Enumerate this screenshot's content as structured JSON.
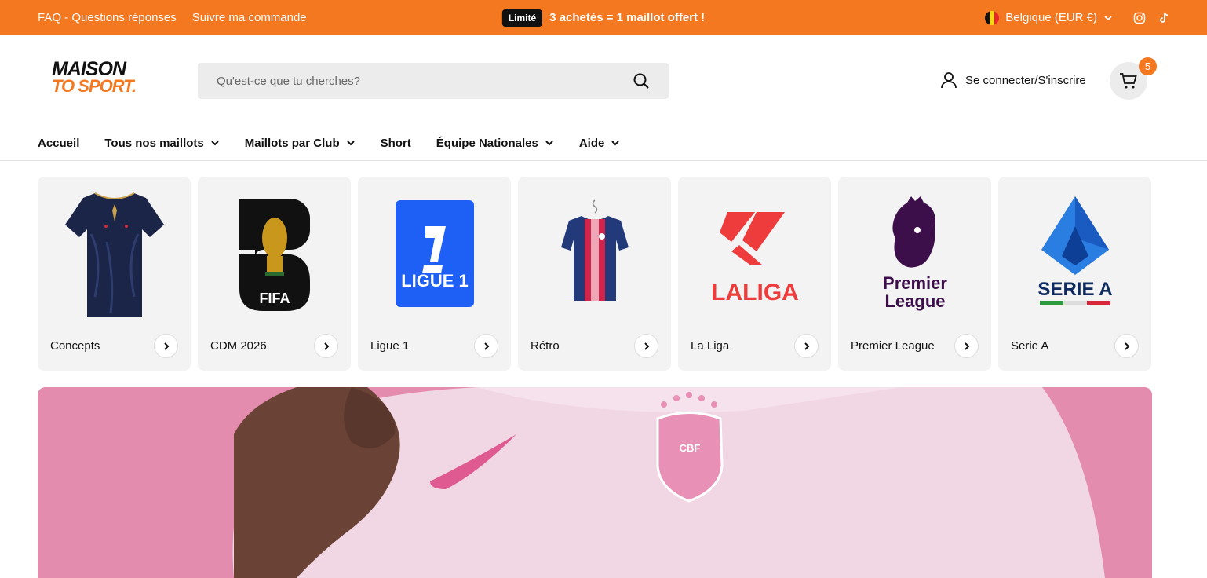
{
  "topbar": {
    "links": [
      "FAQ - Questions réponses",
      "Suivre ma commande"
    ],
    "badge": "Limité",
    "promo": "3 achetés = 1 maillot offert !",
    "country": "Belgique (EUR €)",
    "social": [
      "instagram-icon",
      "tiktok-icon"
    ],
    "background": "#f47820"
  },
  "header": {
    "logo_line1": "MAISON",
    "logo_line2": "TO SPORT.",
    "search_placeholder": "Qu'est-ce que tu cherches?",
    "account_label": "Se connecter/S'inscrire",
    "cart_count": "5"
  },
  "nav": {
    "items": [
      {
        "label": "Accueil",
        "dropdown": false
      },
      {
        "label": "Tous nos maillots",
        "dropdown": true
      },
      {
        "label": "Maillots par Club",
        "dropdown": true
      },
      {
        "label": "Short",
        "dropdown": false
      },
      {
        "label": "Équipe Nationales",
        "dropdown": true
      },
      {
        "label": "Aide",
        "dropdown": true
      }
    ]
  },
  "categories": [
    {
      "label": "Concepts",
      "icon": "concept-jersey-image"
    },
    {
      "label": "CDM 2026",
      "icon": "fifa-2026-logo"
    },
    {
      "label": "Ligue 1",
      "icon": "ligue1-logo"
    },
    {
      "label": "Rétro",
      "icon": "retro-jersey-image"
    },
    {
      "label": "La Liga",
      "icon": "laliga-logo"
    },
    {
      "label": "Premier League",
      "icon": "premier-league-logo"
    },
    {
      "label": "Serie A",
      "icon": "serie-a-logo"
    }
  ],
  "logo_text": {
    "fifa": "FIFA",
    "ligue1": "LIGUE 1",
    "laliga": "LALIGA",
    "pl1": "Premier",
    "pl2": "League",
    "seriea": "SERIE A",
    "cbf": "CBF"
  }
}
